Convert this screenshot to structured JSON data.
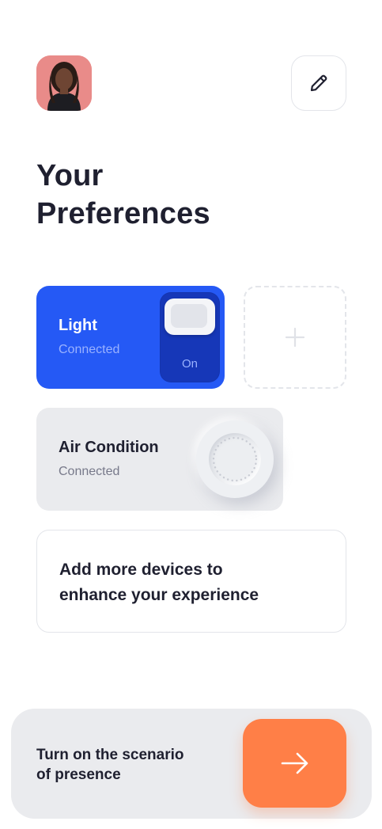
{
  "header": {
    "avatar_alt": "User avatar",
    "edit_icon": "pencil-icon"
  },
  "page": {
    "title": "Your\nPreferences"
  },
  "devices": {
    "light": {
      "name": "Light",
      "status": "Connected",
      "toggle_label": "On",
      "is_on": true,
      "color": "#2559f5"
    },
    "add_slot_icon": "plus-icon",
    "air_condition": {
      "name": "Air Condition",
      "status": "Connected"
    }
  },
  "info": {
    "text": "Add more devices to\nenhance your experience"
  },
  "scenario": {
    "text": "Turn on the scenario\nof presence",
    "button_icon": "arrow-right-icon",
    "accent": "#ff7f47"
  }
}
